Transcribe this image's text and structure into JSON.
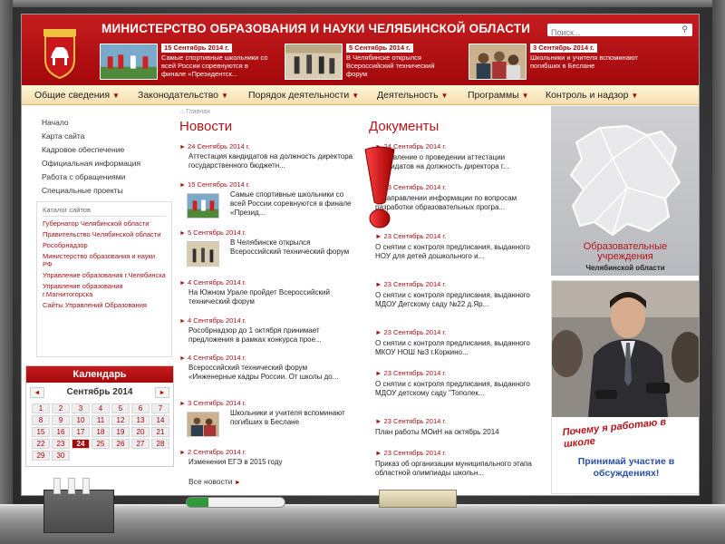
{
  "site": {
    "title": "МИНИСТЕРСТВО ОБРАЗОВАНИЯ И НАУКИ ЧЕЛЯБИНСКОЙ ОБЛАСТИ",
    "search_placeholder": "Поиск...",
    "accent_color": "#b3141a"
  },
  "slides": [
    {
      "date": "15 Сентябрь 2014 г.",
      "text": "Самые спортивные школьники со всей России соревнуются в финале «Президентск..."
    },
    {
      "date": "5 Сентябрь 2014 г.",
      "text": "В Челябинске открылся Всероссийский технический форум"
    },
    {
      "date": "3 Сентябрь 2014 г.",
      "text": "Школьники и учителя вспоминают погибших в Беслане"
    }
  ],
  "nav": [
    "Общие сведения",
    "Законодательство",
    "Порядок деятельности",
    "Деятельность",
    "Программы",
    "Контроль и надзор"
  ],
  "leftnav": [
    "Начало",
    "Карта сайта",
    "Кадровое обеспечение",
    "Официальная информация",
    "Работа с обращениями",
    "Специальные проекты"
  ],
  "catalog": {
    "title": "Каталог сайтов",
    "items": [
      "Губернатор Челябинской области",
      "Правительство Челябинской области",
      "Рособрнадзор",
      "Министерство образования и науки РФ",
      "Управление образования г.Челябинска",
      "Управление образования г.Магнитогорска",
      "Сайты Управлений Образования"
    ]
  },
  "calendar": {
    "title": "Календарь",
    "month": "Сентябрь 2014",
    "prev": "◄",
    "next": "►",
    "days": [
      "1",
      "2",
      "3",
      "4",
      "5",
      "6",
      "7",
      "8",
      "9",
      "10",
      "11",
      "12",
      "13",
      "14",
      "15",
      "16",
      "17",
      "18",
      "19",
      "20",
      "21",
      "22",
      "23",
      "24",
      "25",
      "26",
      "27",
      "28",
      "29",
      "30"
    ],
    "today": "24"
  },
  "breadcrumb": "Главная",
  "news": {
    "title": "Новости",
    "items": [
      {
        "date": "24 Сентябрь 2014 г.",
        "text": "Аттестация кандидатов на должность директора государственного бюджетн..."
      },
      {
        "date": "15 Сентябрь 2014 г.",
        "text": "Самые спортивные школьники со всей России соревнуются в финале «Презид..."
      },
      {
        "date": "5 Сентябрь 2014 г.",
        "text": "В Челябинске открылся Всероссийский технический форум"
      },
      {
        "date": "4 Сентябрь 2014 г.",
        "text": "На Южном Урале пройдет Всероссийский технический форум"
      },
      {
        "date": "4 Сентябрь 2014 г.",
        "text": "Рособрнадзор до 1 октября принимает предложения в рамках конкурса прое..."
      },
      {
        "date": "4 Сентябрь 2014 г.",
        "text": "Всероссийский технический форум «Инженерные кадры России. От школы до..."
      },
      {
        "date": "3 Сентябрь 2014 г.",
        "text": "Школьники и учителя вспоминают погибших в Беслане"
      },
      {
        "date": "2 Сентябрь 2014 г.",
        "text": "Изменения ЕГЭ в 2015 году"
      }
    ],
    "more": "Все новости"
  },
  "documents": {
    "title": "Документы",
    "items": [
      {
        "date": "24 Сентябрь 2014 г.",
        "text": "Объявление о проведении аттестации кандидатов на должность директора г..."
      },
      {
        "date": "23 Сентябрь 2014 г.",
        "text": "О направлении информации по вопросам разработки образовательных програ..."
      },
      {
        "date": "23 Сентябрь 2014 г.",
        "text": "О снятии с контроля предлисания, выданного НОУ для детей дошкольного и..."
      },
      {
        "date": "23 Сентябрь 2014 г.",
        "text": "О снятии с контроля предлисания, выданного МДОУ Детскому саду №22 д.Яр..."
      },
      {
        "date": "23 Сентябрь 2014 г.",
        "text": "О снятии с контроля предлисания, выданного МКОУ НОШ №3 г.Коркино..."
      },
      {
        "date": "23 Сентябрь 2014 г.",
        "text": "О снятии с контроля предлисания, выданного МДОУ детскому саду \"Тополек..."
      },
      {
        "date": "23 Сентябрь 2014 г.",
        "text": "План работы МОиН на октябрь 2014"
      },
      {
        "date": "23 Сентябрь 2014 г.",
        "text": "Приказ об организации муниципального этапа областной олимпиады школьн..."
      }
    ]
  },
  "right": {
    "map_title": "Образовательные учреждения",
    "map_subtitle": "Челябинской области",
    "promo_question": "Почему я работаю в школе",
    "promo_note": "Принимай участие в обсуждениях!"
  }
}
